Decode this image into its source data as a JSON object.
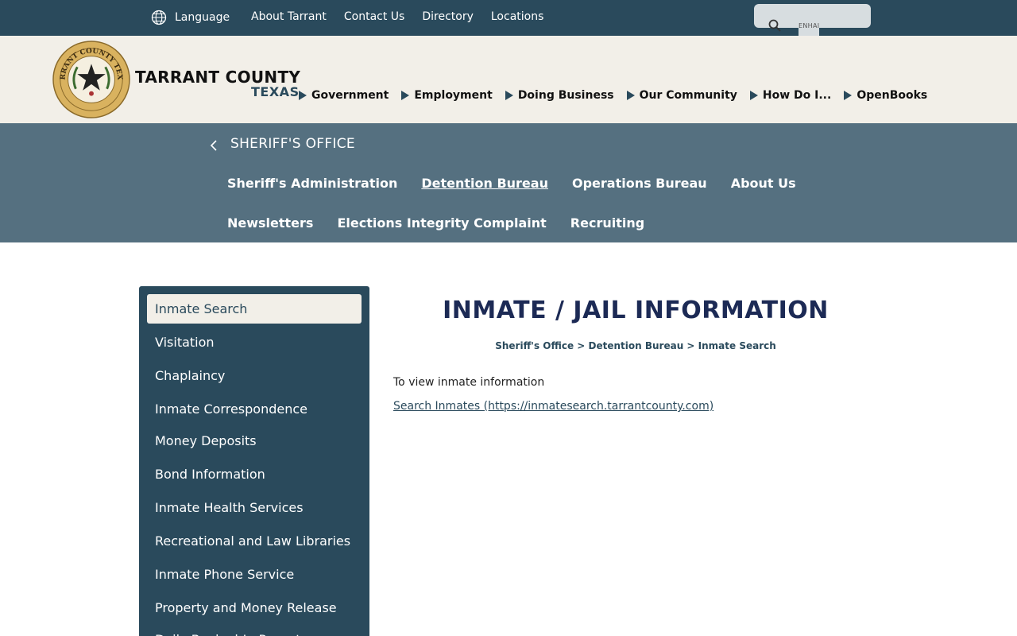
{
  "topbar": {
    "language_label": "Language",
    "links": [
      "About Tarrant",
      "Contact Us",
      "Directory",
      "Locations"
    ],
    "search_enhanced_label": "ENHAI"
  },
  "header": {
    "title": "TARRANT COUNTY",
    "subtitle": "TEXAS",
    "seal_text": "TARRANT COUNTY TEXAS",
    "nav": [
      "Government",
      "Employment",
      "Doing Business",
      "Our Community",
      "How Do I...",
      "OpenBooks"
    ]
  },
  "office": {
    "name": "SHERIFF'S OFFICE",
    "subnav_row1": [
      "Sheriff's Administration",
      "Detention Bureau",
      "Operations Bureau",
      "About Us"
    ],
    "subnav_row2": [
      "Newsletters",
      "Elections Integrity Complaint",
      "Recruiting"
    ],
    "active_item": "Detention Bureau"
  },
  "sidebar": {
    "items": [
      "Inmate Search",
      "Visitation",
      "Chaplaincy",
      "Inmate Correspondence",
      "Money Deposits",
      "Bond Information",
      "Inmate Health Services",
      "Recreational and Law Libraries",
      "Inmate Phone Service",
      "Property and Money Release",
      "Daily Booked-In Report"
    ],
    "active_item": "Inmate Search"
  },
  "main": {
    "title": "INMATE / JAIL INFORMATION",
    "breadcrumb": "Sheriff's Office > Detention Bureau > Inmate Search",
    "intro": "To view inmate information",
    "link_text": "Search Inmates (https://inmatesearch.tarrantcounty.com)"
  },
  "colors": {
    "topbar": "#2a4a5c",
    "header_bg": "#f2efe8",
    "band": "#557080",
    "title": "#1c2a55"
  }
}
